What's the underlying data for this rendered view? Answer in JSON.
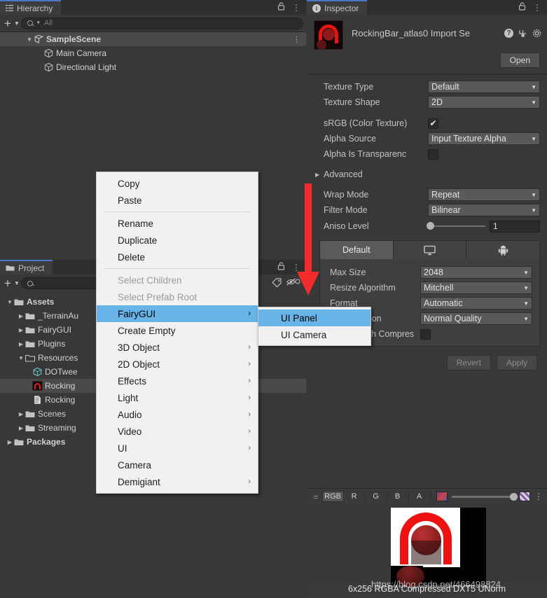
{
  "hierarchy": {
    "tab_label": "Hierarchy",
    "tab_icon": "hierarchy-icon",
    "lock_icon": "lock-icon",
    "menu_icon": "kebab-icon",
    "add_label": "+",
    "search_placeholder": "All",
    "search_value": "",
    "items": [
      {
        "label": "SampleScene",
        "icon": "scene-icon",
        "depth": 1,
        "expanded": true,
        "selected": true,
        "has_menu": true
      },
      {
        "label": "Main Camera",
        "icon": "gameobject-cube-icon",
        "depth": 2,
        "expanded": false,
        "selected": false,
        "has_menu": false
      },
      {
        "label": "Directional Light",
        "icon": "gameobject-cube-icon",
        "depth": 2,
        "expanded": false,
        "selected": false,
        "has_menu": false
      }
    ]
  },
  "project": {
    "tab_label": "Project",
    "tab_icon": "folder-icon",
    "lock_icon": "lock-icon",
    "menu_icon": "kebab-icon",
    "add_label": "+",
    "search_placeholder": "",
    "search_value": "",
    "items": [
      {
        "label": "Assets",
        "icon": "folder-icon",
        "depth": 0,
        "expanded": true,
        "bold": true,
        "selected": false
      },
      {
        "label": "_TerrainAu",
        "icon": "folder-icon",
        "depth": 1,
        "expanded": false,
        "bold": false,
        "selected": false
      },
      {
        "label": "FairyGUI",
        "icon": "folder-icon",
        "depth": 1,
        "expanded": false,
        "bold": false,
        "selected": false
      },
      {
        "label": "Plugins",
        "icon": "folder-icon",
        "depth": 1,
        "expanded": false,
        "bold": false,
        "selected": false
      },
      {
        "label": "Resources",
        "icon": "folder-open-icon",
        "depth": 1,
        "expanded": true,
        "bold": false,
        "selected": false
      },
      {
        "label": "DOTwee",
        "icon": "prefab-cube-icon",
        "depth": 2,
        "expanded": false,
        "bold": false,
        "selected": false
      },
      {
        "label": "Rocking",
        "icon": "texture-icon",
        "depth": 2,
        "expanded": false,
        "bold": false,
        "selected": true
      },
      {
        "label": "Rocking",
        "icon": "textasset-icon",
        "depth": 2,
        "expanded": false,
        "bold": false,
        "selected": false
      },
      {
        "label": "Scenes",
        "icon": "folder-icon",
        "depth": 1,
        "expanded": false,
        "bold": false,
        "selected": false
      },
      {
        "label": "Streaming",
        "icon": "folder-icon",
        "depth": 1,
        "expanded": false,
        "bold": false,
        "selected": false
      },
      {
        "label": "Packages",
        "icon": "folder-icon",
        "depth": 0,
        "expanded": false,
        "bold": true,
        "selected": false
      }
    ]
  },
  "inspector": {
    "tab_label": "Inspector",
    "tab_icon": "info-icon",
    "lock_icon": "lock-icon",
    "menu_icon": "kebab-icon",
    "title": "RockingBar_atlas0 Import Se",
    "help_icon": "help-icon",
    "preset_icon": "preset-icon",
    "settings_icon": "gear-icon",
    "open_label": "Open",
    "fields": [
      {
        "label": "Texture Type",
        "type": "dropdown",
        "value": "Default"
      },
      {
        "label": "Texture Shape",
        "type": "dropdown",
        "value": "2D"
      },
      {
        "label": "sRGB (Color Texture)",
        "type": "checkbox",
        "checked": true
      },
      {
        "label": "Alpha Source",
        "type": "dropdown",
        "value": "Input Texture Alpha"
      },
      {
        "label": "Alpha Is Transparenc",
        "type": "checkbox",
        "checked": false
      }
    ],
    "advanced_label": "Advanced",
    "advanced_expanded": false,
    "fields2": [
      {
        "label": "Wrap Mode",
        "type": "dropdown",
        "value": "Repeat"
      },
      {
        "label": "Filter Mode",
        "type": "dropdown",
        "value": "Bilinear"
      }
    ],
    "aniso_label": "Aniso Level",
    "aniso_value": "1",
    "platform_tabs": [
      {
        "label": "Default",
        "icon": "",
        "active": true
      },
      {
        "label": "",
        "icon": "monitor-icon",
        "active": false
      },
      {
        "label": "",
        "icon": "android-icon",
        "active": false
      }
    ],
    "platform_fields": [
      {
        "label": "Max Size",
        "type": "dropdown",
        "value": "2048"
      },
      {
        "label": "Resize Algorithm",
        "type": "dropdown",
        "value": "Mitchell"
      },
      {
        "label": "Format",
        "type": "dropdown",
        "value": "Automatic"
      },
      {
        "label": "Compression",
        "type": "dropdown",
        "value": "Normal Quality"
      },
      {
        "label": "Use Crunch Compres",
        "type": "checkbox",
        "checked": false
      }
    ],
    "revert_label": "Revert",
    "apply_label": "Apply",
    "preview": {
      "channels": [
        "RGB",
        "R",
        "G",
        "B",
        "A"
      ],
      "active_channel": "RGB",
      "mip_icon": "texture-thumb-icon",
      "alpha_icon": "checker-icon",
      "menu_icon": "kebab-icon",
      "status": "6x256  RGBA Compressed DXT5 UNorm"
    }
  },
  "context_menu": {
    "items": [
      {
        "label": "Copy",
        "disabled": false,
        "submenu": false,
        "highlight": false
      },
      {
        "label": "Paste",
        "disabled": false,
        "submenu": false,
        "highlight": false
      },
      {
        "separator": true
      },
      {
        "label": "Rename",
        "disabled": false,
        "submenu": false,
        "highlight": false
      },
      {
        "label": "Duplicate",
        "disabled": false,
        "submenu": false,
        "highlight": false
      },
      {
        "label": "Delete",
        "disabled": false,
        "submenu": false,
        "highlight": false
      },
      {
        "separator": true
      },
      {
        "label": "Select Children",
        "disabled": true,
        "submenu": false,
        "highlight": false
      },
      {
        "label": "Select Prefab Root",
        "disabled": true,
        "submenu": false,
        "highlight": false
      },
      {
        "label": "FairyGUI",
        "disabled": false,
        "submenu": true,
        "highlight": true
      },
      {
        "label": "Create Empty",
        "disabled": false,
        "submenu": false,
        "highlight": false
      },
      {
        "label": "3D Object",
        "disabled": false,
        "submenu": true,
        "highlight": false
      },
      {
        "label": "2D Object",
        "disabled": false,
        "submenu": true,
        "highlight": false
      },
      {
        "label": "Effects",
        "disabled": false,
        "submenu": true,
        "highlight": false
      },
      {
        "label": "Light",
        "disabled": false,
        "submenu": true,
        "highlight": false
      },
      {
        "label": "Audio",
        "disabled": false,
        "submenu": true,
        "highlight": false
      },
      {
        "label": "Video",
        "disabled": false,
        "submenu": true,
        "highlight": false
      },
      {
        "label": "UI",
        "disabled": false,
        "submenu": true,
        "highlight": false
      },
      {
        "label": "Camera",
        "disabled": false,
        "submenu": false,
        "highlight": false
      },
      {
        "label": "Demigiant",
        "disabled": false,
        "submenu": true,
        "highlight": false
      }
    ]
  },
  "submenu": {
    "items": [
      {
        "label": "UI Panel",
        "highlight": true
      },
      {
        "label": "UI Camera",
        "highlight": false
      }
    ]
  },
  "annotation": {
    "arrow_icon": "red-down-arrow",
    "arrow_color": "#f22c2c"
  },
  "watermark": {
    "text": "https://blog.csdn.net/466498824"
  },
  "colors": {
    "panel_bg": "#383838",
    "tab_bg": "#3c3c3c",
    "accent_blue": "#4a78c8",
    "menu_highlight": "#68b3e8",
    "arrow_red": "#f22c2c"
  }
}
